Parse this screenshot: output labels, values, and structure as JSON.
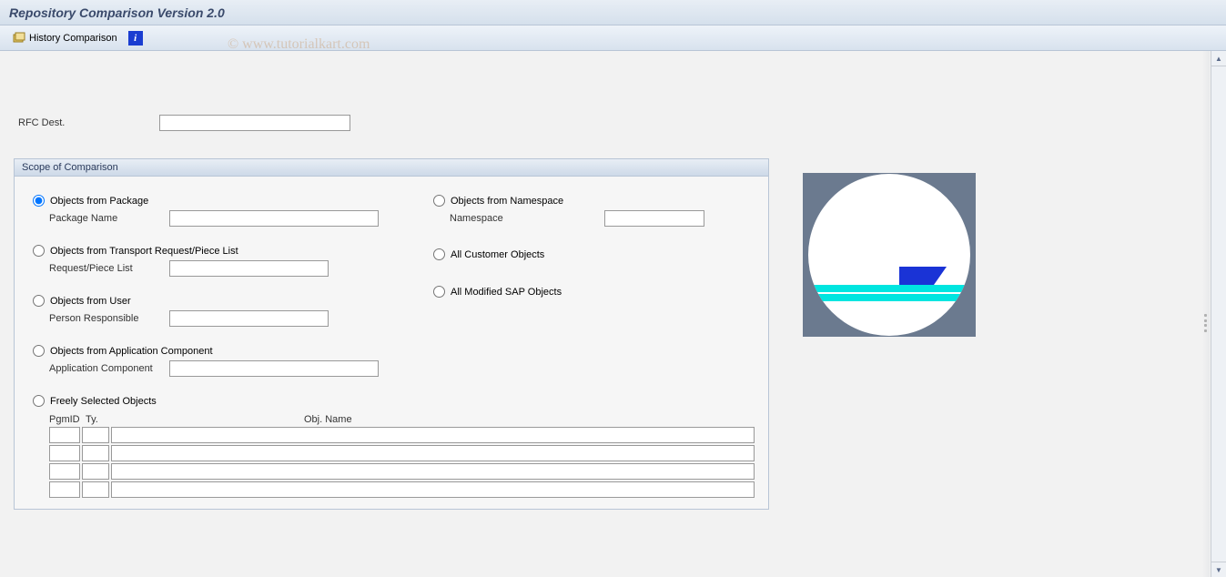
{
  "title": "Repository Comparison Version 2.0",
  "toolbar": {
    "history_label": "History Comparison"
  },
  "watermark": "© www.tutorialkart.com",
  "rfc": {
    "label": "RFC Dest.",
    "value": ""
  },
  "group": {
    "title": "Scope of Comparison",
    "left": {
      "opt_package": "Objects from Package",
      "package_label": "Package Name",
      "package_value": "",
      "opt_transport": "Objects from Transport Request/Piece List",
      "transport_label": "Request/Piece List",
      "transport_value": "",
      "opt_user": "Objects from User",
      "user_label": "Person Responsible",
      "user_value": "",
      "opt_appcomp": "Objects from Application Component",
      "appcomp_label": "Application Component",
      "appcomp_value": "",
      "opt_free": "Freely Selected Objects",
      "th_pgmid": "PgmID",
      "th_ty": "Ty.",
      "th_obj": "Obj. Name"
    },
    "right": {
      "opt_namespace": "Objects from Namespace",
      "namespace_label": "Namespace",
      "namespace_value": "",
      "opt_customer": "All Customer Objects",
      "opt_modified": "All Modified SAP Objects"
    }
  }
}
